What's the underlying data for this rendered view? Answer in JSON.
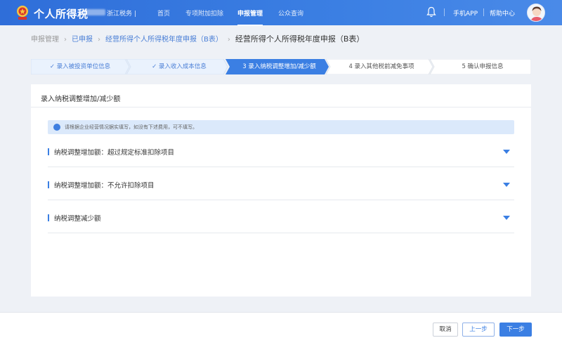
{
  "header": {
    "app_title": "个人所得税",
    "region": "浙江税务 |",
    "nav": [
      "首页",
      "专项附加扣除",
      "申报管理",
      "公众查询"
    ],
    "active_nav": "申报管理",
    "mobile_app": "手机APP",
    "help": "帮助中心"
  },
  "breadcrumb": [
    "申报管理",
    "已申报",
    "经营所得个人所得税年度申报（B表）",
    "经营所得个人所得税年度申报（B表）"
  ],
  "steps": [
    {
      "label": "✓ 录入被投资单位信息",
      "state": "done"
    },
    {
      "label": "✓ 录入收入成本信息",
      "state": "done"
    },
    {
      "label": "3 录入纳税调整增加/减少额",
      "state": "active"
    },
    {
      "label": "4 录入其他税前减免事项",
      "state": "todo"
    },
    {
      "label": "5 确认申报信息",
      "state": "todo"
    }
  ],
  "panel": {
    "title": "录入纳税调整增加/减少额",
    "notice": "请根据企业经营情况据实填写，如没有下述费用，可不填写。",
    "rows": [
      "纳税调整增加额：超过规定标准扣除项目",
      "纳税调整增加额：不允许扣除项目",
      "纳税调整减少额"
    ]
  },
  "footer": {
    "cancel": "取消",
    "prev": "上一步",
    "next": "下一步"
  },
  "colors": {
    "brand_blue": "#3b7fe3",
    "step_done": "#4a7fd6",
    "notice_bg": "#dbe9fb"
  }
}
